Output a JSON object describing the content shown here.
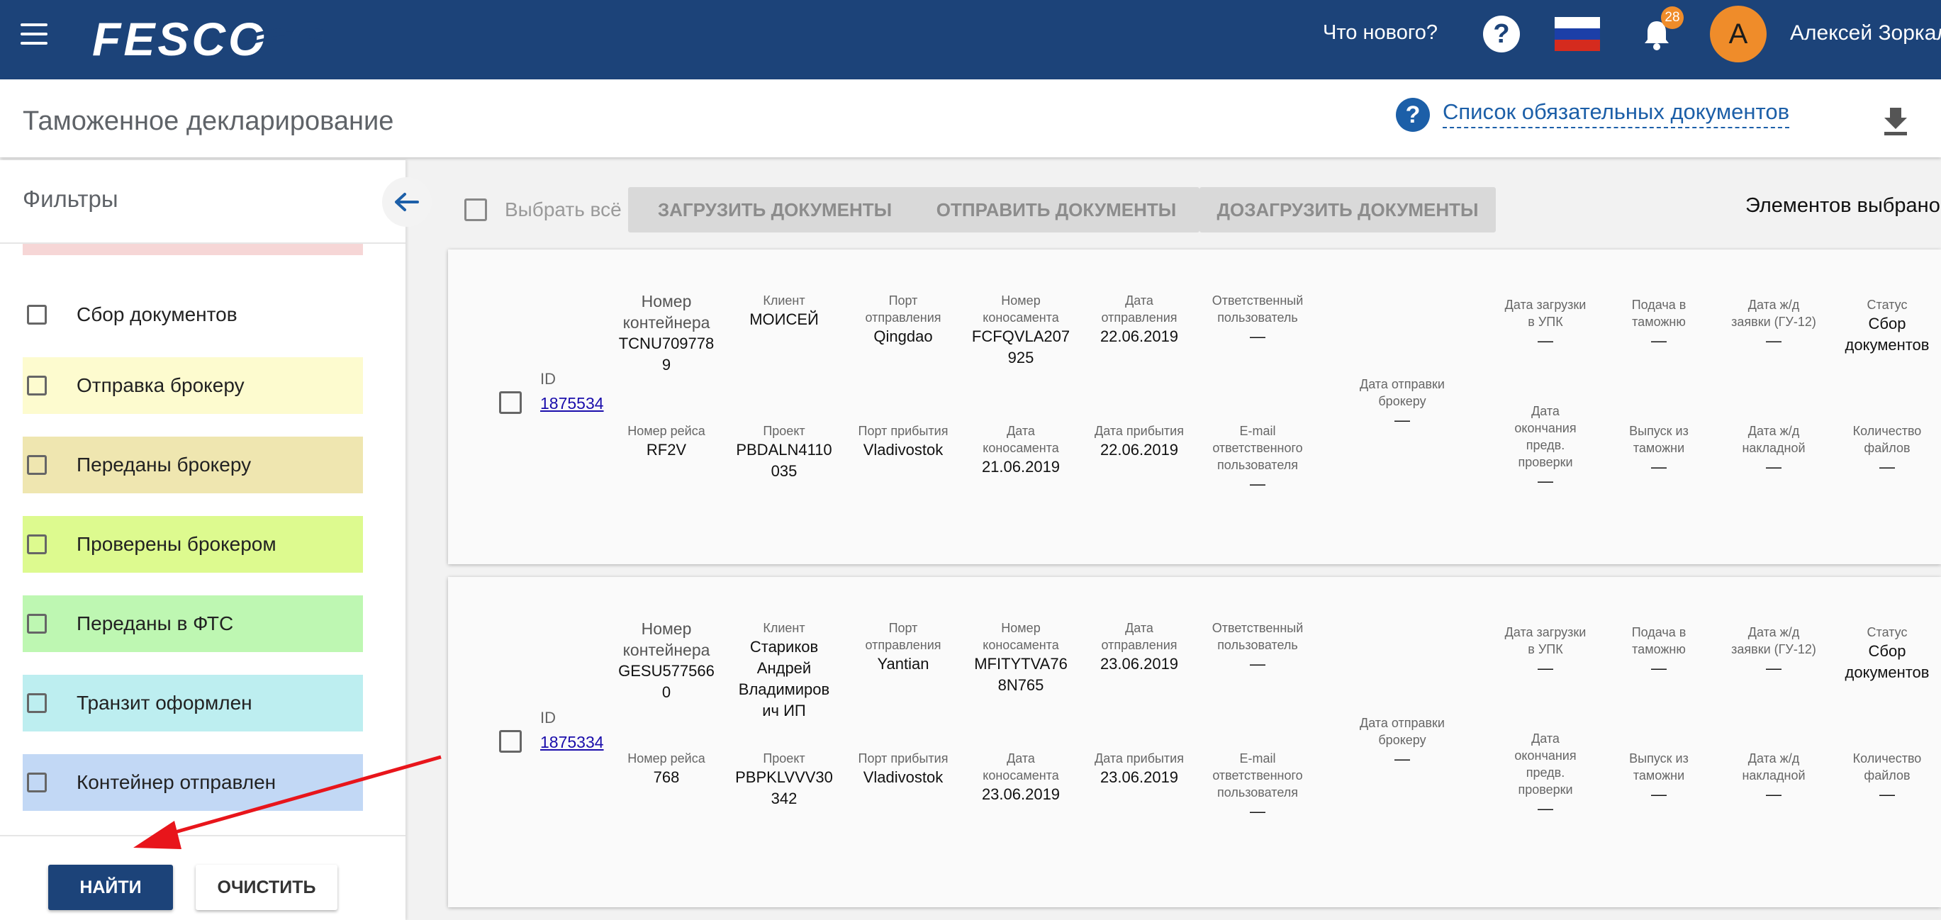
{
  "header": {
    "logo_text": "FESCO",
    "whats_new": "Что нового?",
    "help_symbol": "?",
    "notifications_count": "28",
    "avatar_letter": "А",
    "user_name": "Алексей Зоркал"
  },
  "page": {
    "title": "Таможенное декларирование",
    "help_symbol": "?",
    "doc_list_link": "Список обязательных документов"
  },
  "sidebar": {
    "title": "Фильтры",
    "filters": [
      {
        "label": "Сбор документов",
        "color": "#ffffff"
      },
      {
        "label": "Отправка брокеру",
        "color": "#fdfbcf"
      },
      {
        "label": "Переданы брокеру",
        "color": "#efe6b0"
      },
      {
        "label": "Проверены брокером",
        "color": "#ddfa8f"
      },
      {
        "label": "Переданы в ФТС",
        "color": "#bef7b2"
      },
      {
        "label": "Транзит оформлен",
        "color": "#bdeef0"
      },
      {
        "label": "Контейнер отправлен",
        "color": "#c2d8f5"
      }
    ],
    "find_button": "НАЙТИ",
    "clear_button": "ОЧИСТИТЬ"
  },
  "toolbar": {
    "select_all": "Выбрать всё",
    "upload_docs": "ЗАГРУЗИТЬ ДОКУМЕНТЫ",
    "send_docs": "ОТПРАВИТЬ ДОКУМЕНТЫ",
    "reupload_docs": "ДОЗАГРУЗИТЬ ДОКУМЕНТЫ",
    "selected_count": "Элементов выбрано:"
  },
  "labels": {
    "id": "ID",
    "container_no": "Номер\nконтейнера",
    "client": "Клиент",
    "port_departure": "Порт\nотправления",
    "bl_no": "Номер\nконосамента",
    "departure_date": "Дата\nотправления",
    "responsible_user": "Ответственный\nпользователь",
    "broker_send_date": "Дата отправки\nброкеру",
    "upk_upload_date": "Дата загрузки\nв УПК",
    "customs_submit": "Подача в\nтаможню",
    "rail_request_date": "Дата ж/д\nзаявки (ГУ-12)",
    "status": "Статус",
    "voyage_no": "Номер рейса",
    "project": "Проект",
    "port_arrival": "Порт прибытия",
    "bl_date": "Дата\nконосамента",
    "arrival_date": "Дата прибытия",
    "responsible_email": "E-mail\nответственного\nпользователя",
    "precheck_end_date": "Дата\nокончания\nпредв.\nпроверки",
    "customs_release": "Выпуск из\nтаможни",
    "rail_waybill_date": "Дата ж/д\nнакладной",
    "files_count": "Количество\nфайлов"
  },
  "records": [
    {
      "id": "1875534",
      "container_no": "TCNU709778\n9",
      "client": "МОИСЕЙ",
      "port_departure": "Qingdao",
      "bl_no": "FCFQVLA207\n925",
      "departure_date": "22.06.2019",
      "responsible_user": "—",
      "broker_send_date": "—",
      "upk_upload_date": "—",
      "customs_submit": "—",
      "rail_request_date": "—",
      "status": "Сбор\nдокументов",
      "voyage_no": "RF2V",
      "project": "PBDALN4110\n035",
      "port_arrival": "Vladivostok",
      "bl_date": "21.06.2019",
      "arrival_date": "22.06.2019",
      "responsible_email": "—",
      "precheck_end_date": "—",
      "customs_release": "—",
      "rail_waybill_date": "—",
      "files_count": "—"
    },
    {
      "id": "1875334",
      "container_no": "GESU577566\n0",
      "client": "Стариков\nАндрей\nВладимиров\nич ИП",
      "port_departure": "Yantian",
      "bl_no": "MFITYTVA76\n8N765",
      "departure_date": "23.06.2019",
      "responsible_user": "—",
      "broker_send_date": "—",
      "upk_upload_date": "—",
      "customs_submit": "—",
      "rail_request_date": "—",
      "status": "Сбор\nдокументов",
      "voyage_no": "768",
      "project": "PBPKLVVV30\n342",
      "port_arrival": "Vladivostok",
      "bl_date": "23.06.2019",
      "arrival_date": "23.06.2019",
      "responsible_email": "—",
      "precheck_end_date": "—",
      "customs_release": "—",
      "rail_waybill_date": "—",
      "files_count": "—"
    }
  ],
  "colors": {
    "header_bg": "#1c4379",
    "accent_orange": "#ef8c2a",
    "link_blue": "#1c5fa8",
    "annotation_arrow": "#e8151b"
  }
}
